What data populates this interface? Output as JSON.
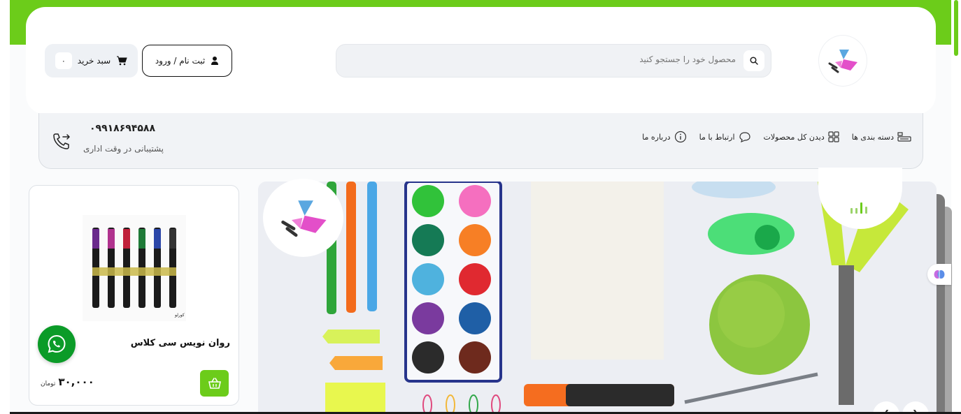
{
  "header": {
    "search_placeholder": "محصول خود را جستجو کنید",
    "login_label": "ثبت نام / ورود",
    "cart_label": "سبد خرید",
    "cart_count": "۰"
  },
  "nav": {
    "items": [
      {
        "label": "دسته بندی ها",
        "icon": "categories-icon"
      },
      {
        "label": "دیدن کل محصولات",
        "icon": "grid-icon"
      },
      {
        "label": "ارتباط با ما",
        "icon": "chat-icon"
      },
      {
        "label": "درباره ما",
        "icon": "info-icon"
      }
    ],
    "support_phone": "۰۹۹۱۸۶۹۴۵۸۸",
    "support_text": "پشتیبانی در وقت اداری"
  },
  "product": {
    "name": "روان نویس سی کلاس",
    "price": "۳۰,۰۰۰",
    "currency": "تومان",
    "brand_mark": "کورلو"
  },
  "colors": {
    "brand_green": "#6ccc1a",
    "whatsapp_green": "#0b9b28",
    "logo_pink": "#e34fc9",
    "logo_blue": "#5aa7e0"
  }
}
